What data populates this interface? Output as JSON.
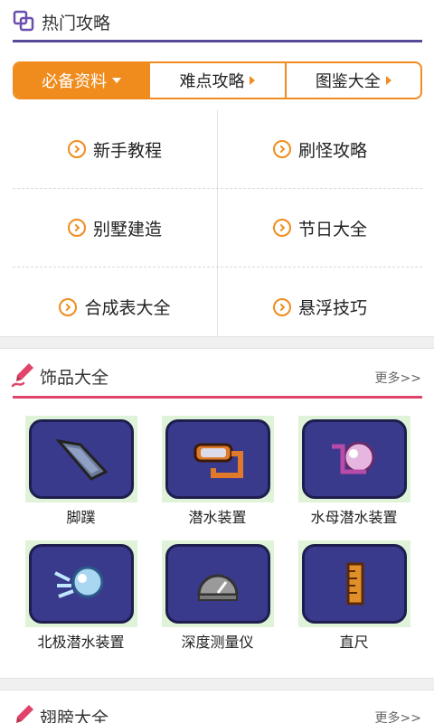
{
  "hot": {
    "title": "热门攻略",
    "tabs": [
      {
        "label": "必备资料",
        "active": true
      },
      {
        "label": "难点攻略",
        "active": false
      },
      {
        "label": "图鉴大全",
        "active": false
      }
    ],
    "links": [
      [
        "新手教程",
        "刷怪攻略"
      ],
      [
        "别墅建造",
        "节日大全"
      ],
      [
        "合成表大全",
        "悬浮技巧"
      ]
    ]
  },
  "accessories": {
    "title": "饰品大全",
    "more": "更多>>",
    "items": [
      {
        "label": "脚蹼",
        "icon": "flipper-icon"
      },
      {
        "label": "潜水装置",
        "icon": "diving-gear-icon"
      },
      {
        "label": "水母潜水装置",
        "icon": "jellyfish-diving-gear-icon"
      },
      {
        "label": "北极潜水装置",
        "icon": "arctic-diving-gear-icon"
      },
      {
        "label": "深度测量仪",
        "icon": "depth-meter-icon"
      },
      {
        "label": "直尺",
        "icon": "ruler-icon"
      }
    ]
  },
  "wings": {
    "title": "翅膀大全",
    "more": "更多>>"
  },
  "colors": {
    "accent_orange": "#f08c1e",
    "header_underline_purple": "#5a4a9a",
    "header_underline_red": "#e0446a",
    "item_bg": "#3a3a8c"
  }
}
